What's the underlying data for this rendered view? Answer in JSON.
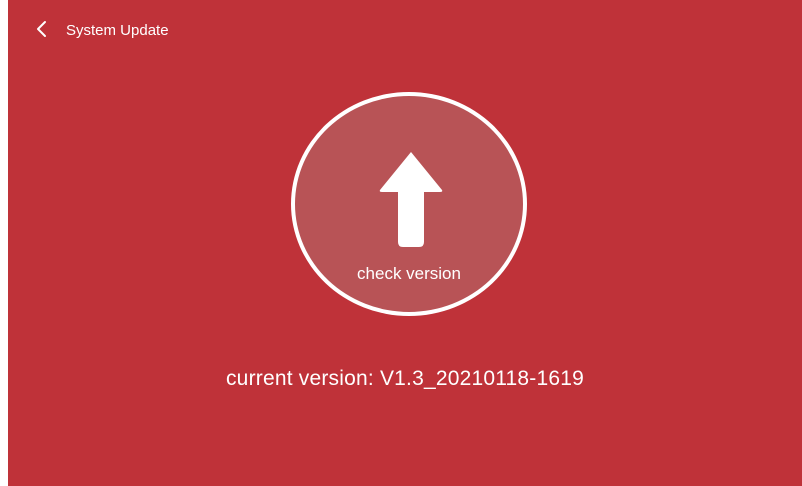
{
  "header": {
    "title": "System Update",
    "back_icon": "chevron-left-icon"
  },
  "main": {
    "check_button_label": "check version",
    "check_icon": "arrow-up-icon",
    "current_version_text": "current version: V1.3_20210118-1619"
  },
  "colors": {
    "background": "#bf3239",
    "circle_fill": "#b85356",
    "foreground": "#ffffff"
  }
}
